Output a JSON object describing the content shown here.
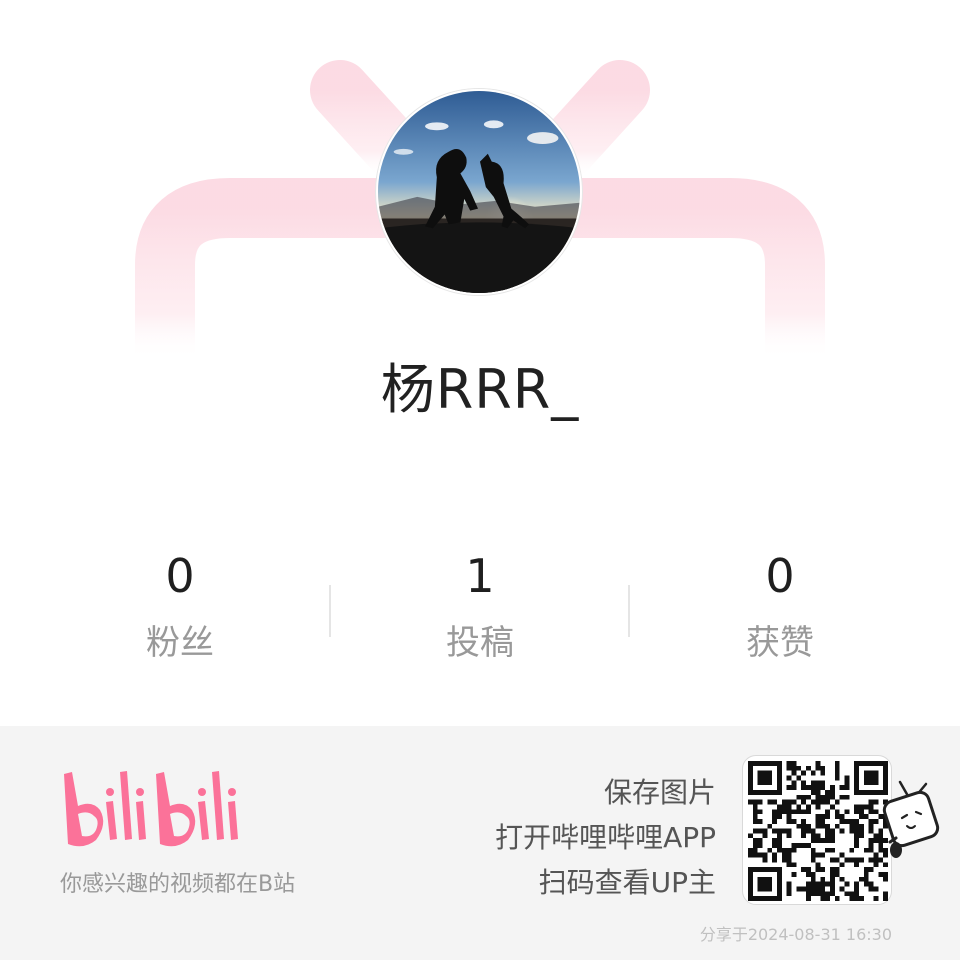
{
  "profile": {
    "username": "杨RRR_",
    "avatar": "avatar-photo-soldier-with-dog-silhouette"
  },
  "stats": [
    {
      "value": "0",
      "label": "粉丝"
    },
    {
      "value": "1",
      "label": "投稿"
    },
    {
      "value": "0",
      "label": "获赞"
    }
  ],
  "footer": {
    "brand": "bilibili",
    "tagline": "你感兴趣的视频都在B站",
    "cta_lines": [
      "保存图片",
      "打开哔哩哔哩APP",
      "扫码查看UP主"
    ],
    "share_time": "分享于2024-08-31 16:30",
    "qr_icon": "qr-code",
    "mascot_icon": "bilibili-tv-mascot"
  },
  "colors": {
    "brand_pink": "#fb7299",
    "deco_pink": "#fde0e7",
    "footer_bg": "#f4f4f4"
  }
}
